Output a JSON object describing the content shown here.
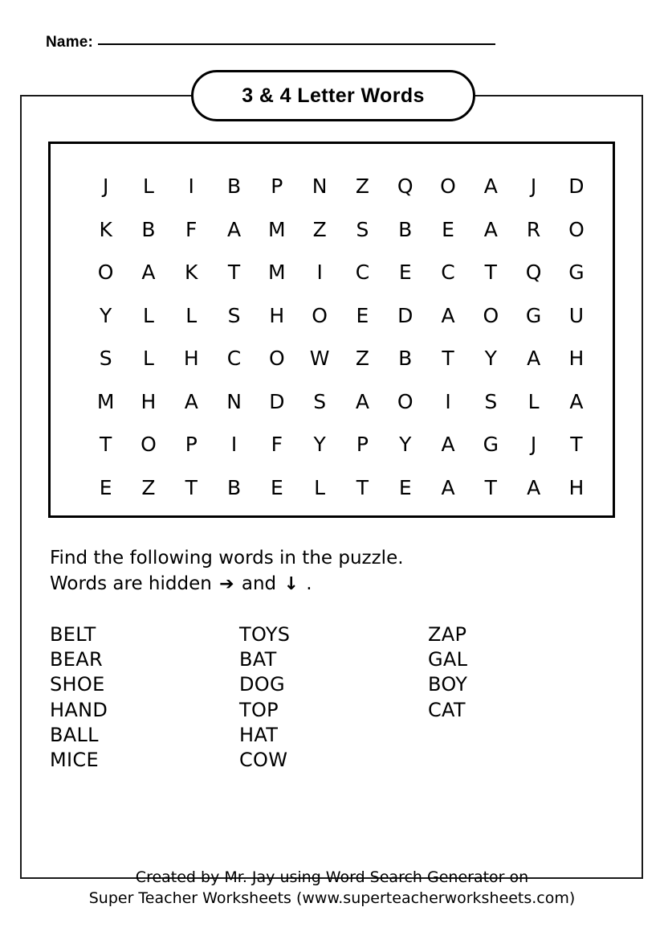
{
  "header": {
    "name_label": "Name:",
    "name_value": ""
  },
  "title": {
    "text": "3 & 4 Letter Words"
  },
  "puzzle": {
    "rows": 8,
    "cols": 12,
    "grid": [
      [
        "J",
        "L",
        "I",
        "B",
        "P",
        "N",
        "Z",
        "Q",
        "O",
        "A",
        "J",
        "D"
      ],
      [
        "K",
        "B",
        "F",
        "A",
        "M",
        "Z",
        "S",
        "B",
        "E",
        "A",
        "R",
        "O"
      ],
      [
        "O",
        "A",
        "K",
        "T",
        "M",
        "I",
        "C",
        "E",
        "C",
        "T",
        "Q",
        "G"
      ],
      [
        "Y",
        "L",
        "L",
        "S",
        "H",
        "O",
        "E",
        "D",
        "A",
        "O",
        "G",
        "U"
      ],
      [
        "S",
        "L",
        "H",
        "C",
        "O",
        "W",
        "Z",
        "B",
        "T",
        "Y",
        "A",
        "H"
      ],
      [
        "M",
        "H",
        "A",
        "N",
        "D",
        "S",
        "A",
        "O",
        "I",
        "S",
        "L",
        "A"
      ],
      [
        "T",
        "O",
        "P",
        "I",
        "F",
        "Y",
        "P",
        "Y",
        "A",
        "G",
        "J",
        "T"
      ],
      [
        "E",
        "Z",
        "T",
        "B",
        "E",
        "L",
        "T",
        "E",
        "A",
        "T",
        "A",
        "H"
      ]
    ]
  },
  "instructions": {
    "line1": "Find the following words in the puzzle.",
    "line2_prefix": "Words are hidden",
    "arrow_right": "➔",
    "line2_middle": "and",
    "arrow_down": "↓",
    "line2_suffix": "."
  },
  "word_list": {
    "columns": [
      {
        "words": [
          "BELT",
          "BEAR",
          "SHOE",
          "HAND",
          "BALL",
          "MICE"
        ]
      },
      {
        "words": [
          "TOYS",
          "BAT",
          "DOG",
          "TOP",
          "HAT",
          "COW"
        ]
      },
      {
        "words": [
          "ZAP",
          "GAL",
          "BOY",
          "CAT"
        ]
      }
    ]
  },
  "footer": {
    "line1": "Created by Mr. Jay using Word Search Generator on",
    "line2": "Super Teacher Worksheets (www.superteacherworksheets.com)"
  },
  "colors": {
    "ink": "#000000",
    "frame": "#1a1a1a",
    "paper": "#ffffff"
  }
}
